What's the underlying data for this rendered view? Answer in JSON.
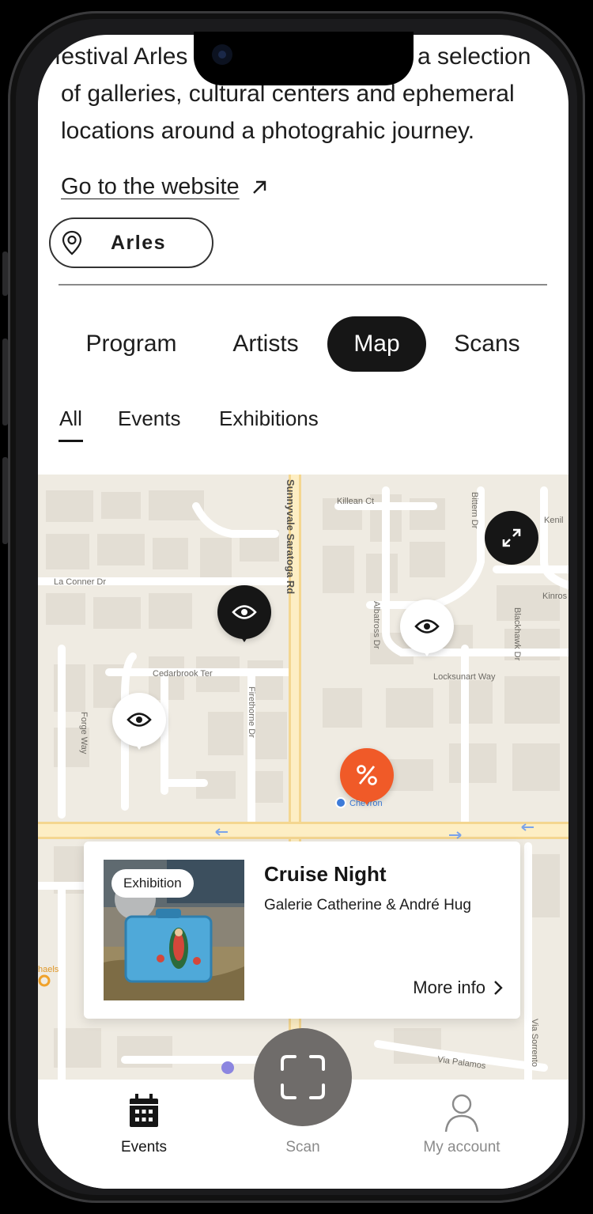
{
  "intro": {
    "text": "estival Arles ... a selection of galleries, cultural centers and ephemeral locations around a photograhic journey.",
    "line1_left": "festival Arles",
    "line1_right": "a selection",
    "line2": "of galleries, cultural centers and ephemeral",
    "line3": "locations around a photograhic journey."
  },
  "website_link": {
    "label": "Go to the website",
    "icon": "arrow-up-right-icon"
  },
  "location": {
    "label": "Arles",
    "icon": "location-pin-icon"
  },
  "tabs": [
    {
      "label": "Program",
      "active": false
    },
    {
      "label": "Artists",
      "active": false
    },
    {
      "label": "Map",
      "active": true
    },
    {
      "label": "Scans",
      "active": false
    }
  ],
  "subtabs": [
    {
      "label": "All",
      "active": true
    },
    {
      "label": "Events",
      "active": false
    },
    {
      "label": "Exhibitions",
      "active": false
    }
  ],
  "map": {
    "street_labels": {
      "sunnyvale": "Sunnyvale Saratoga Rd",
      "killean": "Killean Ct",
      "bittern": "Bittern Dr",
      "la_conner": "La Conner Dr",
      "albatross": "Albatross Dr",
      "kinross": "Kinros",
      "kenil": "Kenil",
      "blackhawk": "Blackhawk Dr",
      "cedarbrook": "Cedarbrook Ter",
      "locksunart": "Locksunart Way",
      "forge": "Forge Way",
      "firethorne": "Firethorne Dr",
      "via_palamos": "Via Palamos",
      "via_sorrento": "Via Sorrento",
      "michaels": "haels"
    },
    "poi_label": "Chevron",
    "marker_icons": [
      "eye-icon",
      "eye-icon",
      "eye-icon",
      "percent-icon"
    ],
    "colors": {
      "accent_orange": "#f05a28",
      "dark": "#161616",
      "map_bg": "#efebe2",
      "poi_blue": "#3d7bd9"
    }
  },
  "card": {
    "badge": "Exhibition",
    "title": "Cruise Night",
    "venue": "Galerie Catherine & André Hug",
    "more": "More info"
  },
  "bottom_nav": {
    "events": "Events",
    "scan": "Scan",
    "account": "My account"
  }
}
